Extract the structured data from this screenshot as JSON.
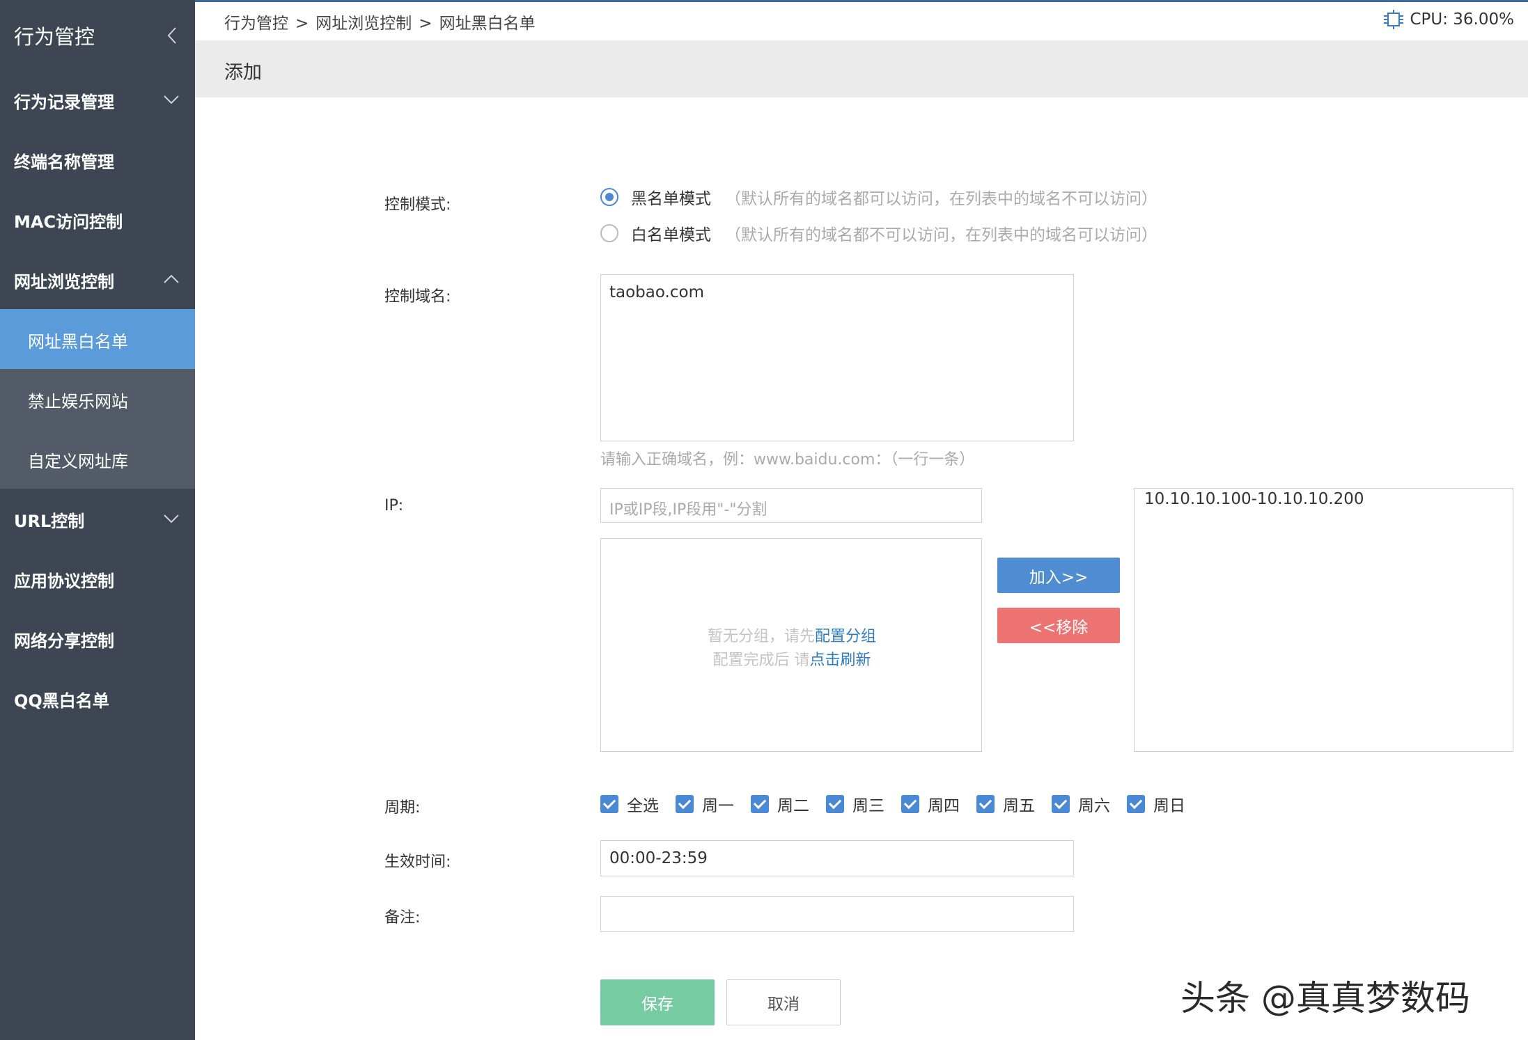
{
  "sidebar": {
    "title": "行为管控",
    "items": [
      {
        "label": "行为记录管理"
      },
      {
        "label": "终端名称管理"
      },
      {
        "label": "MAC访问控制"
      },
      {
        "label": "网址浏览控制"
      },
      {
        "label": "URL控制"
      },
      {
        "label": "应用协议控制"
      },
      {
        "label": "网络分享控制"
      },
      {
        "label": "QQ黑白名单"
      }
    ],
    "subitems": [
      {
        "label": "网址黑白名单",
        "active": true
      },
      {
        "label": "禁止娱乐网站"
      },
      {
        "label": "自定义网址库"
      }
    ]
  },
  "header": {
    "breadcrumb": [
      "行为管控",
      "网址浏览控制",
      "网址黑白名单"
    ],
    "separator": ">",
    "cpu": "CPU: 36.00%"
  },
  "page_title": "添加",
  "form": {
    "mode_label": "控制模式:",
    "modes": [
      {
        "label": "黑名单模式",
        "hint": "（默认所有的域名都可以访问，在列表中的域名不可以访问）",
        "selected": true
      },
      {
        "label": "白名单模式",
        "hint": "（默认所有的域名都不可以访问，在列表中的域名可以访问）",
        "selected": false
      }
    ],
    "domain_label": "控制域名:",
    "domain_value": "taobao.com",
    "domain_hint": "请输入正确域名，例：www.baidu.com：（一行一条）",
    "ip_label": "IP:",
    "ip_placeholder": "IP或IP段,IP段用\"-\"分割",
    "group_msg1_prefix": "暂无分组，请先",
    "group_msg1_link": "配置分组",
    "group_msg2_prefix": "配置完成后 请",
    "group_msg2_link": "点击刷新",
    "add_button": "加入>>",
    "remove_button": "<<移除",
    "ip_list": [
      "10.10.10.100-10.10.10.200"
    ],
    "period_label": "周期:",
    "days": [
      "全选",
      "周一",
      "周二",
      "周三",
      "周四",
      "周五",
      "周六",
      "周日"
    ],
    "time_label": "生效时间:",
    "time_value": "00:00-23:59",
    "note_label": "备注:",
    "note_value": "",
    "save_button": "保存",
    "cancel_button": "取消"
  },
  "watermark": "头条 @真真梦数码",
  "colors": {
    "sidebar_bg": "#3d4652",
    "sidebar_sub_bg": "#525b67",
    "sidebar_active": "#5b9bd9",
    "accent": "#4a8ad4",
    "add_btn": "#4f8cd2",
    "remove_btn": "#ed7272",
    "save_btn": "#76cba2"
  }
}
